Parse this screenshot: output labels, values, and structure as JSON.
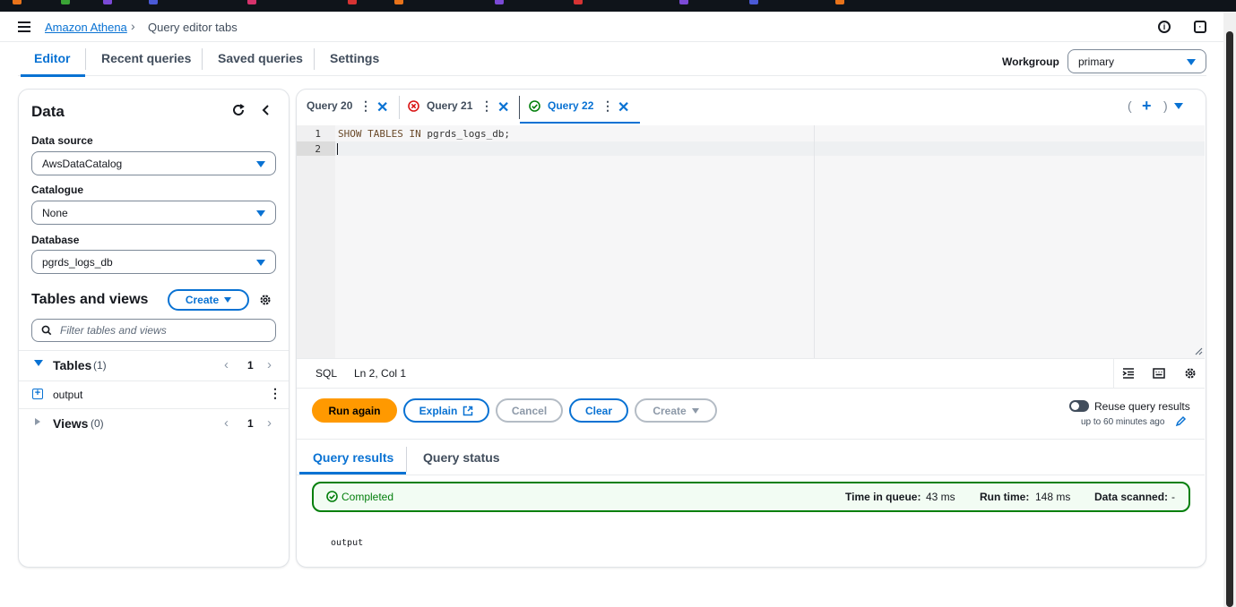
{
  "header": {
    "crumb_root": "Amazon Athena",
    "crumb_current": "Query editor tabs"
  },
  "nav": {
    "tabs": [
      "Editor",
      "Recent queries",
      "Saved queries",
      "Settings"
    ],
    "workgroup_label": "Workgroup",
    "workgroup_value": "primary"
  },
  "data_panel": {
    "title": "Data",
    "data_source_label": "Data source",
    "data_source_value": "AwsDataCatalog",
    "catalogue_label": "Catalogue",
    "catalogue_value": "None",
    "database_label": "Database",
    "database_value": "pgrds_logs_db",
    "tables_views_title": "Tables and views",
    "create_label": "Create",
    "filter_placeholder": "Filter tables and views",
    "tables_label": "Tables",
    "tables_count": "(1)",
    "tables_page": "1",
    "table_item": "output",
    "views_label": "Views",
    "views_count": "(0)",
    "views_page": "1"
  },
  "query_tabs": [
    {
      "label": "Query 20",
      "status": "none"
    },
    {
      "label": "Query 21",
      "status": "error"
    },
    {
      "label": "Query 22",
      "status": "success"
    }
  ],
  "editor": {
    "line_numbers": [
      "1",
      "2"
    ],
    "code_kw": "SHOW TABLES IN",
    "code_rest": " pgrds_logs_db;",
    "language": "SQL",
    "cursor": "Ln 2, Col 1"
  },
  "actions": {
    "run_again": "Run again",
    "explain": "Explain",
    "cancel": "Cancel",
    "clear": "Clear",
    "create": "Create",
    "reuse_label": "Reuse query results",
    "reuse_sub": "up to 60 minutes ago"
  },
  "results": {
    "tabs": [
      "Query results",
      "Query status"
    ],
    "status": "Completed",
    "time_in_queue_label": "Time in queue:",
    "time_in_queue_value": "43 ms",
    "run_time_label": "Run time:",
    "run_time_value": "148 ms",
    "data_scanned_label": "Data scanned:",
    "data_scanned_value": "-",
    "output_text": "output"
  },
  "colors": {
    "accent": "#0972d3",
    "success": "#037f0c",
    "error": "#d91515",
    "primary_button": "#ff9900"
  }
}
